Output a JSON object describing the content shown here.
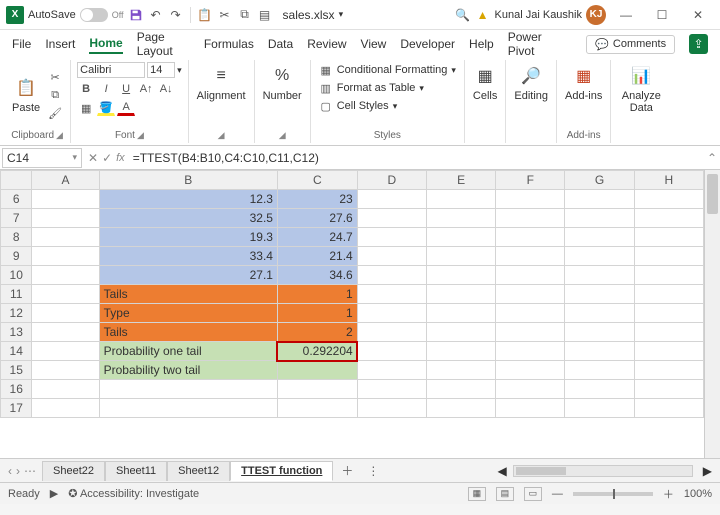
{
  "titlebar": {
    "autosave_label": "AutoSave",
    "autosave_state": "Off",
    "filename": "sales.xlsx",
    "user_name": "Kunal Jai Kaushik",
    "user_initials": "KJ"
  },
  "menu": {
    "items": [
      "File",
      "Insert",
      "Home",
      "Page Layout",
      "Formulas",
      "Data",
      "Review",
      "View",
      "Developer",
      "Help",
      "Power Pivot"
    ],
    "active": "Home",
    "comments": "Comments"
  },
  "ribbon": {
    "clipboard": {
      "paste": "Paste",
      "label": "Clipboard"
    },
    "font": {
      "name": "Calibri",
      "size": "14",
      "label": "Font"
    },
    "alignment": {
      "label": "Alignment",
      "btn": "Alignment"
    },
    "number": {
      "label": "Number",
      "btn": "Number"
    },
    "styles": {
      "label": "Styles",
      "cond": "Conditional Formatting",
      "table": "Format as Table",
      "cell": "Cell Styles"
    },
    "cells": {
      "btn": "Cells"
    },
    "editing": {
      "btn": "Editing"
    },
    "addins": {
      "btn": "Add-ins",
      "label": "Add-ins"
    },
    "analyze": {
      "btn": "Analyze Data"
    }
  },
  "formula": {
    "cell_ref": "C14",
    "text": "=TTEST(B4:B10,C4:C10,C11,C12)"
  },
  "columns": [
    "A",
    "B",
    "C",
    "D",
    "E",
    "F",
    "G",
    "H"
  ],
  "rows": [
    {
      "n": 6,
      "b": "12.3",
      "c": "23",
      "style": "blue"
    },
    {
      "n": 7,
      "b": "32.5",
      "c": "27.6",
      "style": "blue"
    },
    {
      "n": 8,
      "b": "19.3",
      "c": "24.7",
      "style": "blue"
    },
    {
      "n": 9,
      "b": "33.4",
      "c": "21.4",
      "style": "blue"
    },
    {
      "n": 10,
      "b": "27.1",
      "c": "34.6",
      "style": "blue"
    },
    {
      "n": 11,
      "b": "Tails",
      "c": "1",
      "style": "orange"
    },
    {
      "n": 12,
      "b": "Type",
      "c": "1",
      "style": "orange"
    },
    {
      "n": 13,
      "b": "Tails",
      "c": "2",
      "style": "orange"
    },
    {
      "n": 14,
      "b": "Probability one tail",
      "c": "0.292204",
      "style": "green",
      "highlight": true
    },
    {
      "n": 15,
      "b": "Probability two tail",
      "c": "",
      "style": "green"
    },
    {
      "n": 16,
      "b": "",
      "c": "",
      "style": ""
    },
    {
      "n": 17,
      "b": "",
      "c": "",
      "style": ""
    }
  ],
  "sheets": {
    "tabs": [
      "Sheet22",
      "Sheet11",
      "Sheet12",
      "TTEST function"
    ],
    "active": "TTEST function"
  },
  "status": {
    "ready": "Ready",
    "access": "Accessibility: Investigate",
    "zoom": "100%"
  }
}
